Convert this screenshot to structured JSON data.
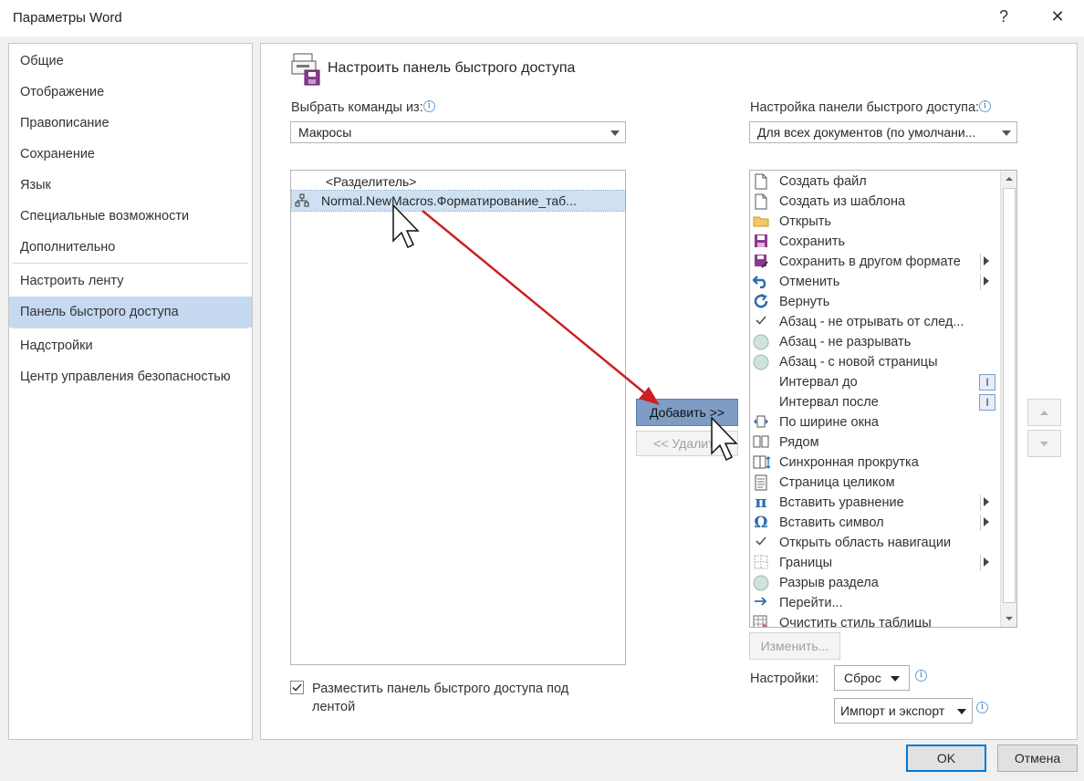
{
  "window": {
    "title": "Параметры Word",
    "help": "?",
    "close": "✕"
  },
  "sidebar": {
    "items": [
      {
        "label": "Общие"
      },
      {
        "label": "Отображение"
      },
      {
        "label": "Правописание"
      },
      {
        "label": "Сохранение"
      },
      {
        "label": "Язык"
      },
      {
        "label": "Специальные возможности"
      },
      {
        "label": "Дополнительно"
      },
      {
        "label": "Настроить ленту"
      },
      {
        "label": "Панель быстрого доступа",
        "selected": true
      },
      {
        "label": "Надстройки"
      },
      {
        "label": "Центр управления безопасностью"
      }
    ]
  },
  "main": {
    "heading": "Настроить панель быстрого доступа",
    "choose_label": "Выбрать команды из:",
    "choose_value": "Макросы",
    "customize_label": "Настройка панели быстрого доступа:",
    "customize_value": "Для всех документов (по умолчани...",
    "commands": [
      {
        "label": "<Разделитель>"
      },
      {
        "label": "Normal.NewMacros.Форматирование_таб...",
        "selected": true
      }
    ],
    "add_button": "Добавить >>",
    "remove_button": "<< Удалить",
    "qa_items": [
      {
        "label": "Создать файл",
        "icon": "new-file-icon"
      },
      {
        "label": "Создать из шаблона",
        "icon": "new-template-icon"
      },
      {
        "label": "Открыть",
        "icon": "folder-icon"
      },
      {
        "label": "Сохранить",
        "icon": "save-icon"
      },
      {
        "label": "Сохранить в другом формате",
        "icon": "save-as-icon",
        "submenu": true
      },
      {
        "label": "Отменить",
        "icon": "undo-icon",
        "submenu": true
      },
      {
        "label": "Вернуть",
        "icon": "redo-icon"
      },
      {
        "label": "Абзац - не отрывать от след...",
        "icon": "check-icon"
      },
      {
        "label": "Абзац - не разрывать",
        "icon": "circle-icon"
      },
      {
        "label": "Абзац - с новой страницы",
        "icon": "circle-icon"
      },
      {
        "label": "Интервал до",
        "icon": "none",
        "spinner": true
      },
      {
        "label": "Интервал после",
        "icon": "none",
        "spinner": true
      },
      {
        "label": "По ширине окна",
        "icon": "page-width-icon"
      },
      {
        "label": "Рядом",
        "icon": "side-by-side-icon"
      },
      {
        "label": "Синхронная прокрутка",
        "icon": "sync-scroll-icon"
      },
      {
        "label": "Страница целиком",
        "icon": "one-page-icon"
      },
      {
        "label": "Вставить уравнение",
        "icon": "pi-icon",
        "submenu": true
      },
      {
        "label": "Вставить символ",
        "icon": "omega-icon",
        "submenu": true
      },
      {
        "label": "Открыть область навигации",
        "icon": "check-icon"
      },
      {
        "label": "Границы",
        "icon": "borders-icon",
        "submenu": true
      },
      {
        "label": "Разрыв раздела",
        "icon": "circle-icon"
      },
      {
        "label": "Перейти...",
        "icon": "arrow-right-icon"
      },
      {
        "label": "Очистить стиль таблицы",
        "icon": "table-icon"
      }
    ],
    "modify_button": "Изменить...",
    "settings_label": "Настройки:",
    "reset_button": "Сброс",
    "import_export_button": "Импорт и экспорт",
    "checkbox_label_line1": "Разместить панель быстрого доступа под",
    "checkbox_label_line2": "лентой",
    "checkbox_checked": true
  },
  "footer": {
    "ok": "OK",
    "cancel": "Отмена"
  },
  "colors": {
    "accent_selection": "#c5d9f1",
    "list_selection": "#cfe0f3",
    "arrow": "#cc1f1f",
    "add_button_bg": "#7f9cc5"
  }
}
